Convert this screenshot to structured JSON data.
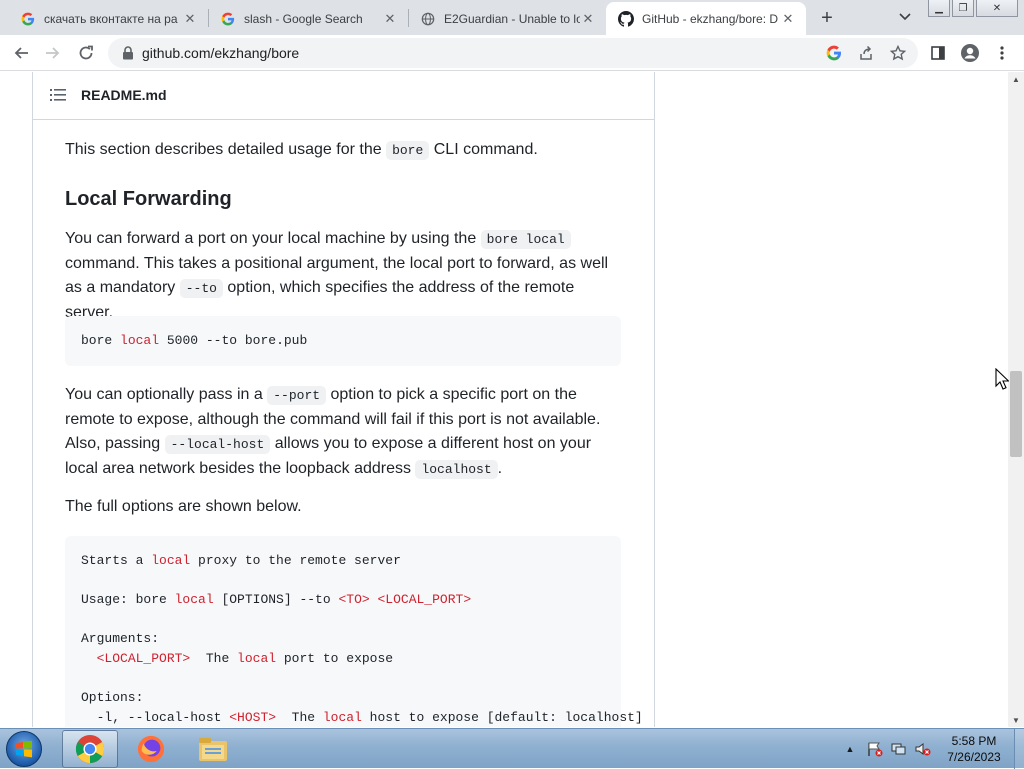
{
  "browser": {
    "tabs": [
      {
        "title": "скачать вконтакте на ра",
        "favicon": "google-icon",
        "active": false
      },
      {
        "title": "slash - Google Search",
        "favicon": "google-icon",
        "active": false
      },
      {
        "title": "E2Guardian - Unable to lo",
        "favicon": "globe-icon",
        "active": false
      },
      {
        "title": "GitHub - ekzhang/bore: D",
        "favicon": "github-icon",
        "active": true
      }
    ],
    "url": "github.com/ekzhang/bore",
    "colors": {
      "tabstrip": "#dee1e6",
      "omnibox": "#f1f3f4"
    }
  },
  "readme": {
    "filename": "README.md",
    "intro": {
      "before": "This section describes detailed usage for the",
      "code": "bore",
      "after": "CLI command."
    },
    "heading": "Local Forwarding",
    "para1": {
      "line1_before": "You can forward a port on your local machine by using the",
      "line1_code": "bore local",
      "line2": "command. This takes a positional argument, the local port to forward, as well",
      "line3_before": "as a mandatory",
      "line3_code": "--to",
      "line3_after": "option, which specifies the address of the remote server."
    },
    "code1": {
      "cmd": "bore",
      "kw": "local",
      "rest": "5000 --to bore.pub"
    },
    "para2": {
      "line1_before": "You can optionally pass in a",
      "line1_code": "--port",
      "line1_after": "option to pick a specific port on the",
      "line2": "remote to expose, although the command will fail if this port is not available.",
      "line3_before": "Also, passing",
      "line3_code": "--local-host",
      "line3_after": "allows you to expose a different host on your",
      "line4_before": "local area network besides the loopback address",
      "line4_code": "localhost",
      "line4_after": "."
    },
    "para3": "The full options are shown below.",
    "code2": {
      "l1_a": "Starts a ",
      "l1_kw": "local",
      "l1_b": " proxy to the remote server",
      "l2_a": "Usage: bore ",
      "l2_kw": "local",
      "l2_b": " [OPTIONS] --to ",
      "l2_to": "<TO>",
      "l2_sp": " ",
      "l2_lp": "<LOCAL_PORT>",
      "l3": "Arguments:",
      "l4_lp": "<LOCAL_PORT>",
      "l4_a": "  The ",
      "l4_kw": "local",
      "l4_b": " port to expose",
      "l5": "Options:",
      "l6_a": "  -l, --local-host ",
      "l6_host": "<HOST>",
      "l6_b": "  The ",
      "l6_kw": "local",
      "l6_c": " host to expose [default: localhost]"
    }
  },
  "taskbar": {
    "apps": [
      "chrome-icon",
      "firefox-icon",
      "explorer-icon"
    ],
    "time": "5:58 PM",
    "date": "7/26/2023"
  }
}
